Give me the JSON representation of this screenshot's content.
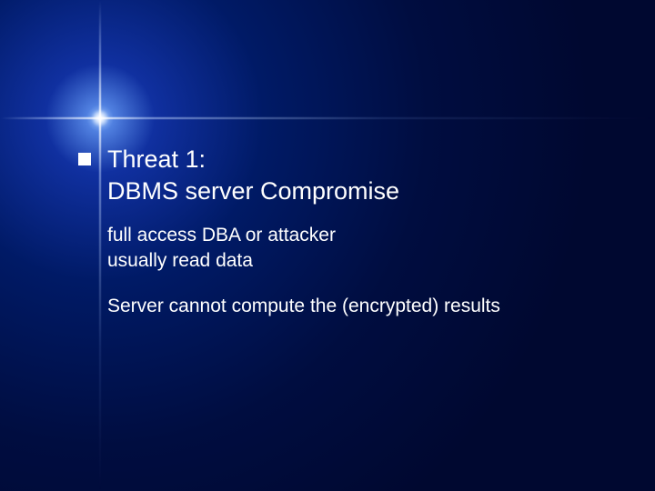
{
  "slide": {
    "title_line1": "Threat 1:",
    "title_line2": "DBMS server Compromise",
    "sub1_line1": "full access DBA or attacker",
    "sub1_line2": "usually read data",
    "sub2": "Server cannot compute the (encrypted) results"
  }
}
